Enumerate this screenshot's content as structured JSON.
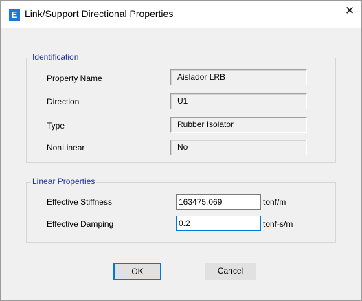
{
  "window": {
    "title": "Link/Support Directional Properties",
    "icon_letter": "E",
    "close_glyph": "✕"
  },
  "identification": {
    "legend": "Identification",
    "rows": [
      {
        "label": "Property Name",
        "value": "Aislador LRB"
      },
      {
        "label": "Direction",
        "value": "U1"
      },
      {
        "label": "Type",
        "value": "Rubber Isolator"
      },
      {
        "label": "NonLinear",
        "value": "No"
      }
    ]
  },
  "linear_properties": {
    "legend": "Linear Properties",
    "effective_stiffness": {
      "label": "Effective Stiffness",
      "value": "163475.069",
      "unit": "tonf/m"
    },
    "effective_damping": {
      "label": "Effective Damping",
      "value": "0.2",
      "unit": "tonf-s/m"
    }
  },
  "buttons": {
    "ok": "OK",
    "cancel": "Cancel"
  },
  "colors": {
    "accent": "#0078d7",
    "group_legend": "#1f2fa3"
  }
}
